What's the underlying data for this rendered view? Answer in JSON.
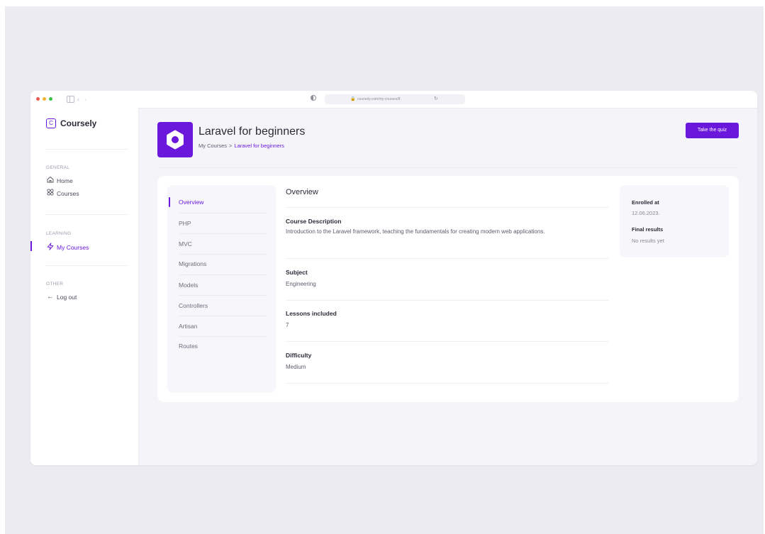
{
  "browser": {
    "url": "coursely.com/my-courses/8",
    "dot_colors": [
      "#ec5a4e",
      "#f2b230",
      "#38c24c"
    ]
  },
  "sidebar": {
    "brand_letter": "C",
    "brand": "Coursely",
    "sections": [
      {
        "label": "GENERAL",
        "items": [
          {
            "label": "Home",
            "icon": "home-icon"
          },
          {
            "label": "Courses",
            "icon": "grid-icon"
          }
        ]
      },
      {
        "label": "LEARNING",
        "items": [
          {
            "label": "My Courses",
            "icon": "lightning-icon",
            "active": true
          }
        ]
      },
      {
        "label": "OTHER",
        "items": [
          {
            "label": "Log out",
            "icon": "arrow-left-icon"
          }
        ]
      }
    ]
  },
  "header": {
    "title": "Laravel for beginners",
    "breadcrumb": [
      "My Courses",
      "Laravel for beginners"
    ],
    "quiz_button": "Take the quiz"
  },
  "subnav": {
    "items": [
      "Overview",
      "PHP",
      "MVC",
      "Migrations",
      "Models",
      "Controllers",
      "Artisan",
      "Routes"
    ],
    "active": "Overview"
  },
  "overview": {
    "title": "Overview",
    "fields": [
      {
        "label": "Course Description",
        "value": "Introduction to the Laravel framework, teaching the fundamentals for creating modern web applications."
      },
      {
        "label": "Subject",
        "value": "Engineering"
      },
      {
        "label": "Lessons included",
        "value": "7"
      },
      {
        "label": "Difficulty",
        "value": "Medium"
      }
    ]
  },
  "info": {
    "enrolled_label": "Enrolled at",
    "enrolled_value": "12.06.2023.",
    "results_label": "Final results",
    "results_value": "No results yet"
  },
  "colors": {
    "accent": "#6a18dc",
    "background": "#ecebf1"
  }
}
